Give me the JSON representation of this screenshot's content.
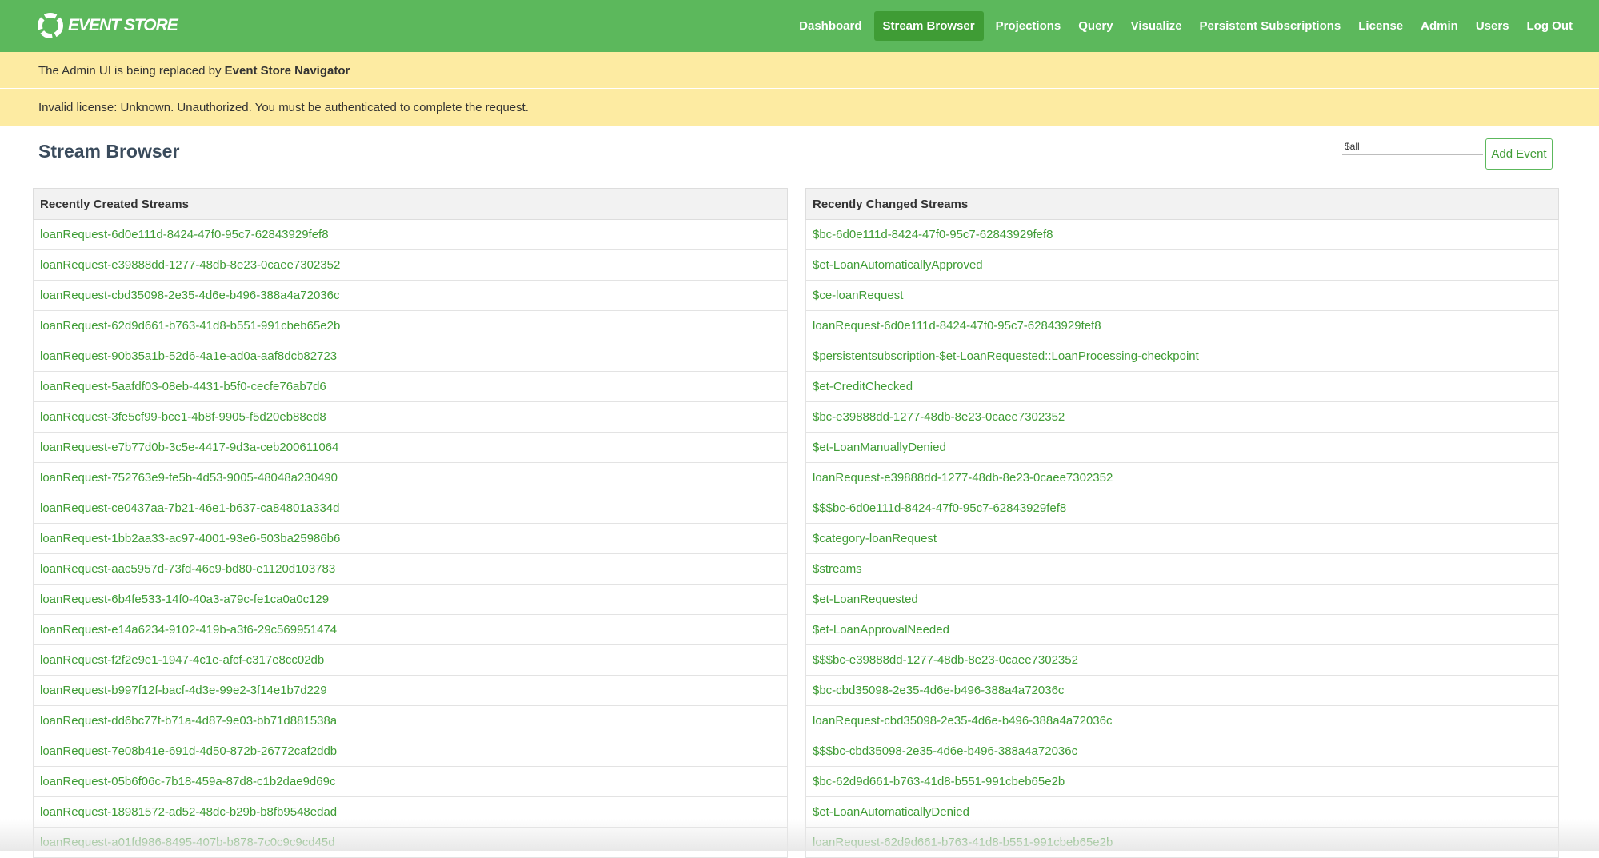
{
  "app": {
    "logo_text": "EVENT STORE",
    "accent_color": "#5cb85c"
  },
  "nav": {
    "items": [
      {
        "label": "Dashboard",
        "active": false
      },
      {
        "label": "Stream Browser",
        "active": true
      },
      {
        "label": "Projections",
        "active": false
      },
      {
        "label": "Query",
        "active": false
      },
      {
        "label": "Visualize",
        "active": false
      },
      {
        "label": "Persistent Subscriptions",
        "active": false
      },
      {
        "label": "License",
        "active": false
      },
      {
        "label": "Admin",
        "active": false
      },
      {
        "label": "Users",
        "active": false
      },
      {
        "label": "Log Out",
        "active": false
      }
    ]
  },
  "banners": {
    "admin_prefix": "The Admin UI is being replaced by ",
    "admin_link": "Event Store Navigator",
    "license_text": "Invalid license: Unknown. Unauthorized. You must be authenticated to complete the request."
  },
  "page": {
    "title": "Stream Browser",
    "stream_input_value": "$all",
    "add_event_label": "Add Event"
  },
  "recently_created": {
    "header": "Recently Created Streams",
    "rows": [
      "loanRequest-6d0e111d-8424-47f0-95c7-62843929fef8",
      "loanRequest-e39888dd-1277-48db-8e23-0caee7302352",
      "loanRequest-cbd35098-2e35-4d6e-b496-388a4a72036c",
      "loanRequest-62d9d661-b763-41d8-b551-991cbeb65e2b",
      "loanRequest-90b35a1b-52d6-4a1e-ad0a-aaf8dcb82723",
      "loanRequest-5aafdf03-08eb-4431-b5f0-cecfe76ab7d6",
      "loanRequest-3fe5cf99-bce1-4b8f-9905-f5d20eb88ed8",
      "loanRequest-e7b77d0b-3c5e-4417-9d3a-ceb200611064",
      "loanRequest-752763e9-fe5b-4d53-9005-48048a230490",
      "loanRequest-ce0437aa-7b21-46e1-b637-ca84801a334d",
      "loanRequest-1bb2aa33-ac97-4001-93e6-503ba25986b6",
      "loanRequest-aac5957d-73fd-46c9-bd80-e1120d103783",
      "loanRequest-6b4fe533-14f0-40a3-a79c-fe1ca0a0c129",
      "loanRequest-e14a6234-9102-419b-a3f6-29c569951474",
      "loanRequest-f2f2e9e1-1947-4c1e-afcf-c317e8cc02db",
      "loanRequest-b997f12f-bacf-4d3e-99e2-3f14e1b7d229",
      "loanRequest-dd6bc77f-b71a-4d87-9e03-bb71d881538a",
      "loanRequest-7e08b41e-691d-4d50-872b-26772caf2ddb",
      "loanRequest-05b6f06c-7b18-459a-87d8-c1b2dae9d69c",
      "loanRequest-18981572-ad52-48dc-b29b-b8fb9548edad",
      "loanRequest-a01fd986-8495-407b-b878-7c0c9c9cd45d"
    ]
  },
  "recently_changed": {
    "header": "Recently Changed Streams",
    "rows": [
      "$bc-6d0e111d-8424-47f0-95c7-62843929fef8",
      "$et-LoanAutomaticallyApproved",
      "$ce-loanRequest",
      "loanRequest-6d0e111d-8424-47f0-95c7-62843929fef8",
      "$persistentsubscription-$et-LoanRequested::LoanProcessing-checkpoint",
      "$et-CreditChecked",
      "$bc-e39888dd-1277-48db-8e23-0caee7302352",
      "$et-LoanManuallyDenied",
      "loanRequest-e39888dd-1277-48db-8e23-0caee7302352",
      "$$$bc-6d0e111d-8424-47f0-95c7-62843929fef8",
      "$category-loanRequest",
      "$streams",
      "$et-LoanRequested",
      "$et-LoanApprovalNeeded",
      "$$$bc-e39888dd-1277-48db-8e23-0caee7302352",
      "$bc-cbd35098-2e35-4d6e-b496-388a4a72036c",
      "loanRequest-cbd35098-2e35-4d6e-b496-388a4a72036c",
      "$$$bc-cbd35098-2e35-4d6e-b496-388a4a72036c",
      "$bc-62d9d661-b763-41d8-b551-991cbeb65e2b",
      "$et-LoanAutomaticallyDenied",
      "loanRequest-62d9d661-b763-41d8-b551-991cbeb65e2b"
    ]
  }
}
